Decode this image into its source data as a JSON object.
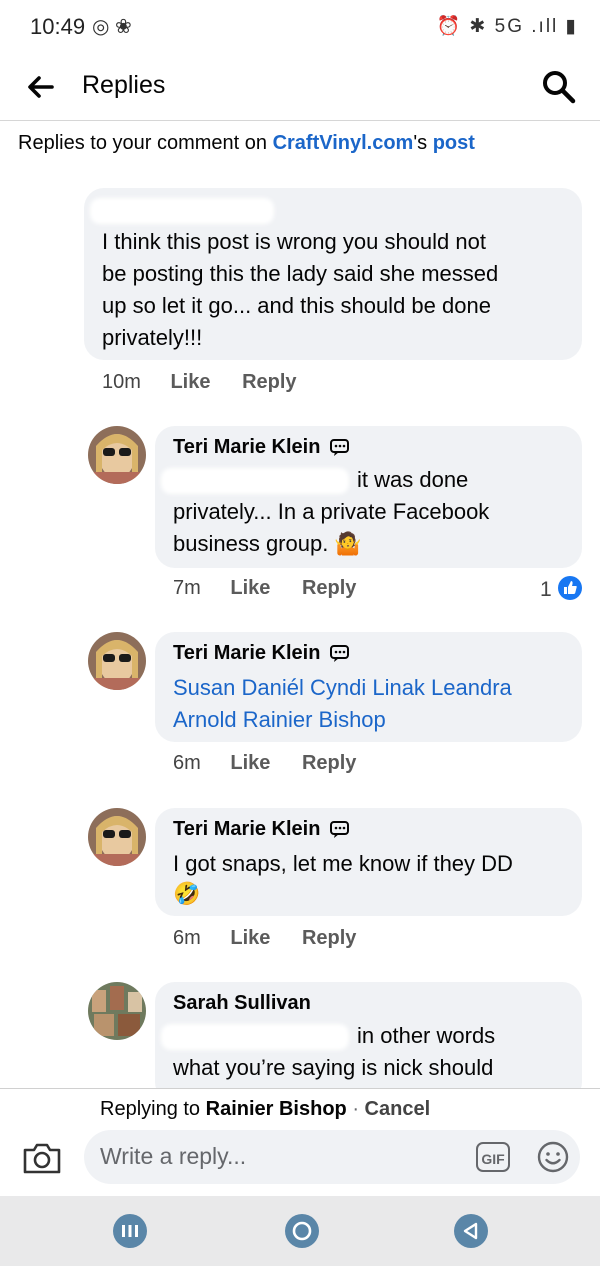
{
  "status_bar": {
    "time": "10:49",
    "left_icons": "◎ ❀",
    "right_icons": "⏰ ✱ 5G .ıll ▮"
  },
  "header": {
    "back_icon": "arrow-left-icon",
    "title": "Replies",
    "search_icon": "search-icon"
  },
  "context": {
    "prefix": "Replies to your comment on ",
    "page_link": "CraftVinyl.com",
    "possessive": "'s ",
    "post_link": "post"
  },
  "main_comment": {
    "text_lines": [
      "I think this post is wrong you should not",
      "be posting this the lady said she messed",
      "up so let it go... and this should be done",
      "privately!!!"
    ],
    "time": "10m",
    "like": "Like",
    "reply": "Reply"
  },
  "replies": [
    {
      "author": "Teri Marie Klein",
      "line1": "it was done",
      "line2": "privately... In a private Facebook",
      "line3": "business group. 🤷",
      "time": "7m",
      "like": "Like",
      "reply": "Reply",
      "reaction_count": "1"
    },
    {
      "author": "Teri Marie Klein",
      "line1": "Susan Daniél Cyndi Linak Leandra",
      "line2": "Arnold Rainier Bishop",
      "time": "6m",
      "like": "Like",
      "reply": "Reply"
    },
    {
      "author": "Teri Marie Klein",
      "line1": "I got snaps, let me know if they DD",
      "line2": "🤣",
      "time": "6m",
      "like": "Like",
      "reply": "Reply"
    },
    {
      "author": "Sarah Sullivan",
      "line1": "in other words",
      "line2": "what you’re saying is nick should"
    }
  ],
  "reply_bar": {
    "replying_prefix": "Replying to ",
    "replying_to": "Rainier Bishop",
    "separator": " · ",
    "cancel": "Cancel",
    "placeholder": "Write a reply...",
    "gif": "GIF"
  },
  "colors": {
    "link": "#1b66c9",
    "bubble": "#f0f2f5",
    "like_badge": "#1877f2",
    "nav_button": "#5a86a8"
  }
}
